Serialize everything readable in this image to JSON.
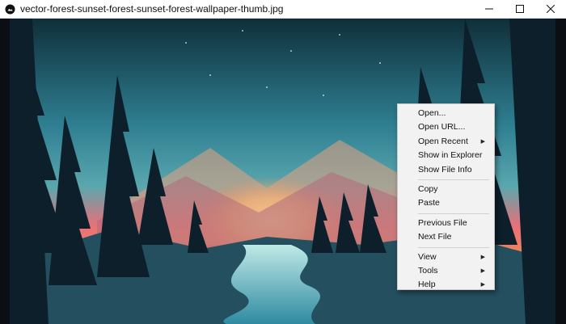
{
  "window": {
    "title": "vector-forest-sunset-forest-sunset-forest-wallpaper-thumb.jpg",
    "icon": "app-circle-icon",
    "controls": [
      "minimize-icon",
      "maximize-icon",
      "close-icon"
    ]
  },
  "viewer": {
    "image_description_icon": "forest-sunset-wallpaper-image"
  },
  "context_menu": {
    "groups": [
      [
        {
          "label": "Open...",
          "submenu": false
        },
        {
          "label": "Open URL...",
          "submenu": false
        },
        {
          "label": "Open Recent",
          "submenu": true
        },
        {
          "label": "Show in Explorer",
          "submenu": false
        },
        {
          "label": "Show File Info",
          "submenu": false
        }
      ],
      [
        {
          "label": "Copy",
          "submenu": false
        },
        {
          "label": "Paste",
          "submenu": false
        }
      ],
      [
        {
          "label": "Previous File",
          "submenu": false
        },
        {
          "label": "Next File",
          "submenu": false
        }
      ],
      [
        {
          "label": "View",
          "submenu": true
        },
        {
          "label": "Tools",
          "submenu": true
        },
        {
          "label": "Help",
          "submenu": true
        }
      ]
    ]
  },
  "colors": {
    "sky_top": "#0f2f3a",
    "sky_mid": "#3c8fa0",
    "sunset_orange": "#f08a4b",
    "sunset_pink": "#e9707a",
    "sun_glow": "#ffe08a",
    "tree_dark": "#0c1f2a",
    "river": "#7fd0dc"
  }
}
